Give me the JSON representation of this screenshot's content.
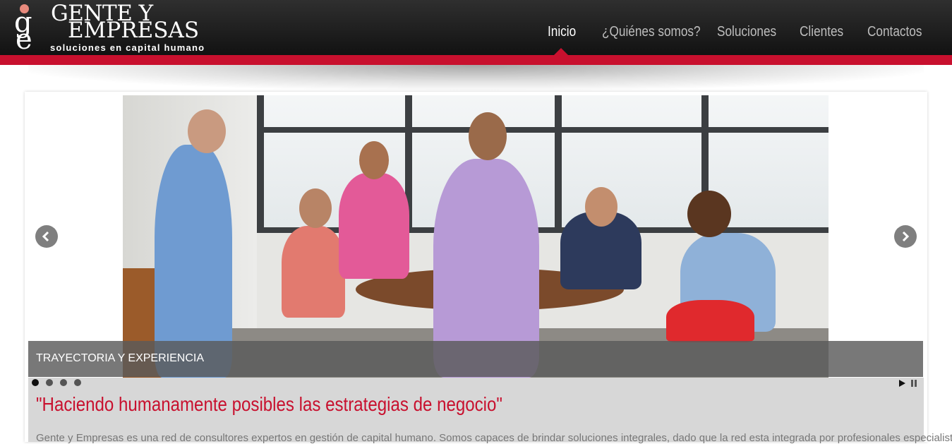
{
  "brand": {
    "name_line1": "GENTE Y",
    "name_line2": "EMPRESAS",
    "tagline": "soluciones en capital humano",
    "colors": {
      "accent": "#c8102e",
      "header": "#1c1c1c",
      "logo_dot": "#e88a7d"
    }
  },
  "nav": {
    "items": [
      {
        "label": "Inicio",
        "active": true
      },
      {
        "label": "¿Quiénes somos?"
      },
      {
        "label": "Soluciones"
      },
      {
        "label": "Clientes"
      },
      {
        "label": "Contactos"
      }
    ]
  },
  "slider": {
    "caption": "TRAYECTORIA Y EXPERIENCIA",
    "current_slide": 1,
    "total_slides": 4,
    "prev_icon": "chevron-left-icon",
    "next_icon": "chevron-right-icon",
    "play_icon": "play-icon",
    "pause_icon": "pause-icon"
  },
  "main": {
    "headline": "\"Haciendo humanamente posibles las estrategias de negocio\"",
    "intro": "Gente y Empresas es una red de consultores expertos en gestión de capital humano. Somos capaces de brindar soluciones integrales, dado que la red esta integrada por profesionales especialistas en los"
  }
}
